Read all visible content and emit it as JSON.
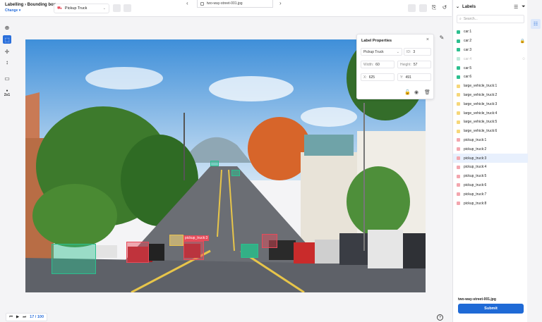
{
  "header": {
    "brand": "Labelling › Bounding box",
    "change_label": "Change",
    "class_select": "Pickup Truck",
    "file_name": "two-way-street-001.jpg"
  },
  "toolbar": {
    "zoom": "2x1"
  },
  "label_properties": {
    "title": "Label Properties",
    "class": "Pickup Truck",
    "id_label": "ID:",
    "id": "3",
    "width_label": "Width:",
    "width": "60",
    "height_label": "Height:",
    "height": "57",
    "x_label": "X:",
    "x": "625",
    "y_label": "Y:",
    "y": "491"
  },
  "labels_panel": {
    "title": "Labels",
    "search_placeholder": "Search...",
    "items": [
      {
        "name": "car:1",
        "color": "#2dbf8f"
      },
      {
        "name": "car:2",
        "color": "#2dbf8f",
        "locked": true
      },
      {
        "name": "car:3",
        "color": "#2dbf8f"
      },
      {
        "name": "car:4",
        "color": "#bfe9da",
        "hidden": true
      },
      {
        "name": "car:5",
        "color": "#2dbf8f"
      },
      {
        "name": "car:6",
        "color": "#2dbf8f"
      },
      {
        "name": "large_vehicle_truck:1",
        "color": "#f6d77a"
      },
      {
        "name": "large_vehicle_truck:2",
        "color": "#f6d77a"
      },
      {
        "name": "large_vehicle_truck:3",
        "color": "#f6d77a"
      },
      {
        "name": "large_vehicle_truck:4",
        "color": "#f6d77a"
      },
      {
        "name": "large_vehicle_truck:5",
        "color": "#f6d77a"
      },
      {
        "name": "large_vehicle_truck:6",
        "color": "#f6d77a"
      },
      {
        "name": "pickup_truck:1",
        "color": "#f3a6ae"
      },
      {
        "name": "pickup_truck:2",
        "color": "#f3a6ae"
      },
      {
        "name": "pickup_truck:3",
        "color": "#f3a6ae",
        "selected": true
      },
      {
        "name": "pickup_truck:4",
        "color": "#f3a6ae"
      },
      {
        "name": "pickup_truck:5",
        "color": "#f3a6ae"
      },
      {
        "name": "pickup_truck:6",
        "color": "#f3a6ae"
      },
      {
        "name": "pickup_truck:7",
        "color": "#f3a6ae"
      },
      {
        "name": "pickup_truck:8",
        "color": "#f3a6ae"
      }
    ],
    "file_name": "two-way-street-001.jpg",
    "submit_label": "Submit"
  },
  "canvas": {
    "box_label": "pickup_truck:3"
  },
  "pagination": {
    "current": "17 / 100"
  },
  "colors": {
    "accent": "#1f6ad6",
    "car": "#2dbf8f",
    "truck": "#f6d77a",
    "pickup": "#e84b5a"
  }
}
